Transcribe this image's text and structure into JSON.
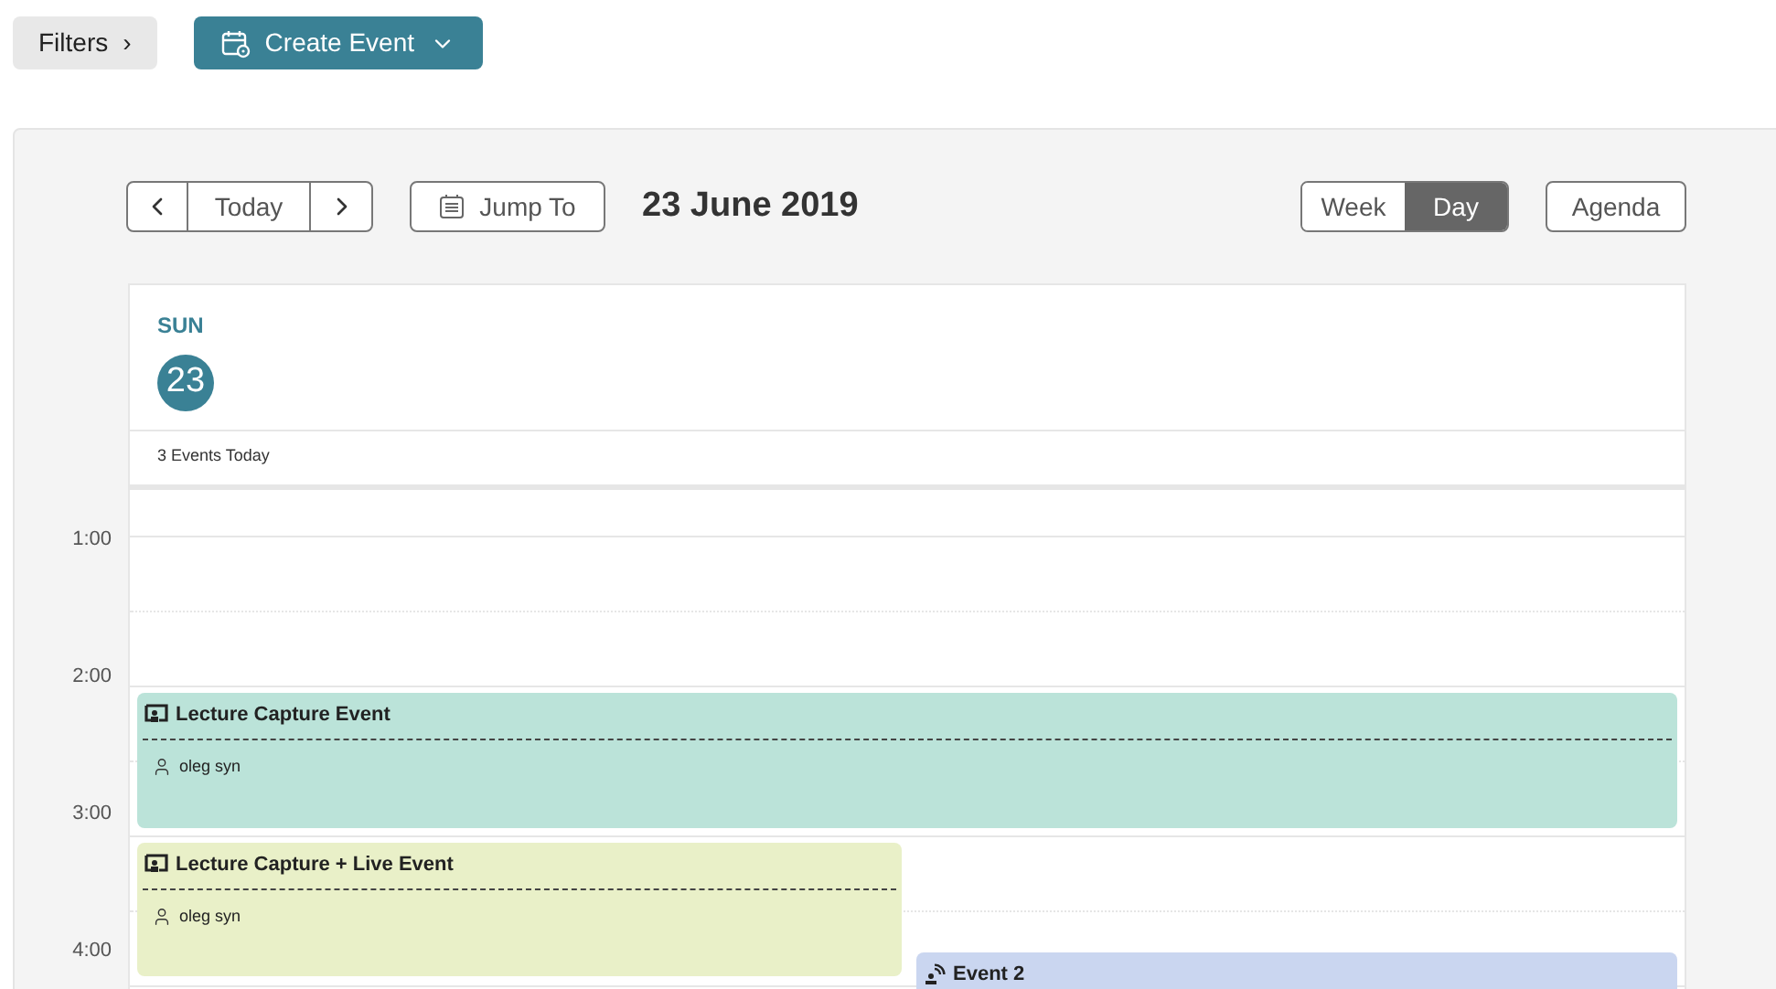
{
  "top_bar": {
    "filters": "Filters",
    "filters_arrow": "›",
    "create": "Create Event"
  },
  "toolbar": {
    "today": "Today",
    "jump": "Jump To",
    "date": "23 June 2019",
    "views": [
      {
        "label": "Week",
        "selected": false
      },
      {
        "label": "Day",
        "selected": true
      }
    ],
    "agenda": "Agenda"
  },
  "day": {
    "weekday": "SUN",
    "number": "23",
    "summary": "3 Events Today"
  },
  "hours": [
    "1:00",
    "2:00",
    "3:00",
    "4:00"
  ],
  "events": [
    {
      "title": "Lecture Capture Event",
      "kind": "lecture",
      "color": "#bbe3d9",
      "person": "oleg syn"
    },
    {
      "title": "Lecture Capture + Live Event",
      "kind": "lecture",
      "color": "#e9f0c8",
      "person": "oleg syn"
    },
    {
      "title": "Event 2",
      "kind": "live",
      "color": "#cad6f0"
    }
  ]
}
